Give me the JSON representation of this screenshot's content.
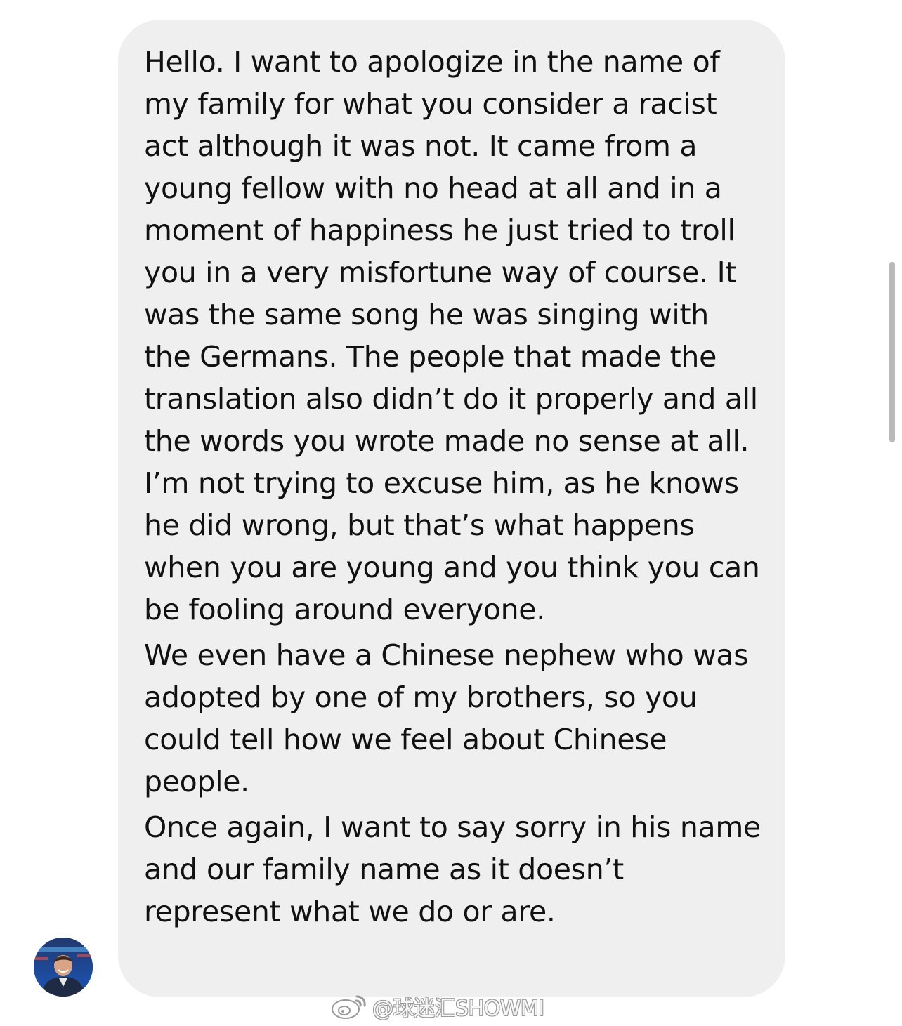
{
  "message": {
    "paragraphs": [
      "Hello. I want to apologize in the name of my family for what you consider a racist act although it was not. It came from a young fellow with no head at all and in a moment of happiness he just tried to troll you in a very misfortune way of course. It was the same song he was singing with the Germans. The people that made the translation also didn’t do it properly and all the words you wrote made no sense at all. I’m not trying to excuse him, as he knows he did wrong, but that’s what happens when you are young and you think you can be fooling around everyone.",
      "We even have a Chinese nephew who was adopted by one of my brothers, so you could tell how we feel about Chinese people.",
      "Once again, I want to say sorry in his name and our family name as it doesn’t represent what we do or are."
    ]
  },
  "watermark": {
    "text": "@球迷汇SHOWMI",
    "icon": "weibo-icon"
  },
  "colors": {
    "bubble": "#efefef",
    "text": "#111111",
    "background": "#ffffff"
  }
}
